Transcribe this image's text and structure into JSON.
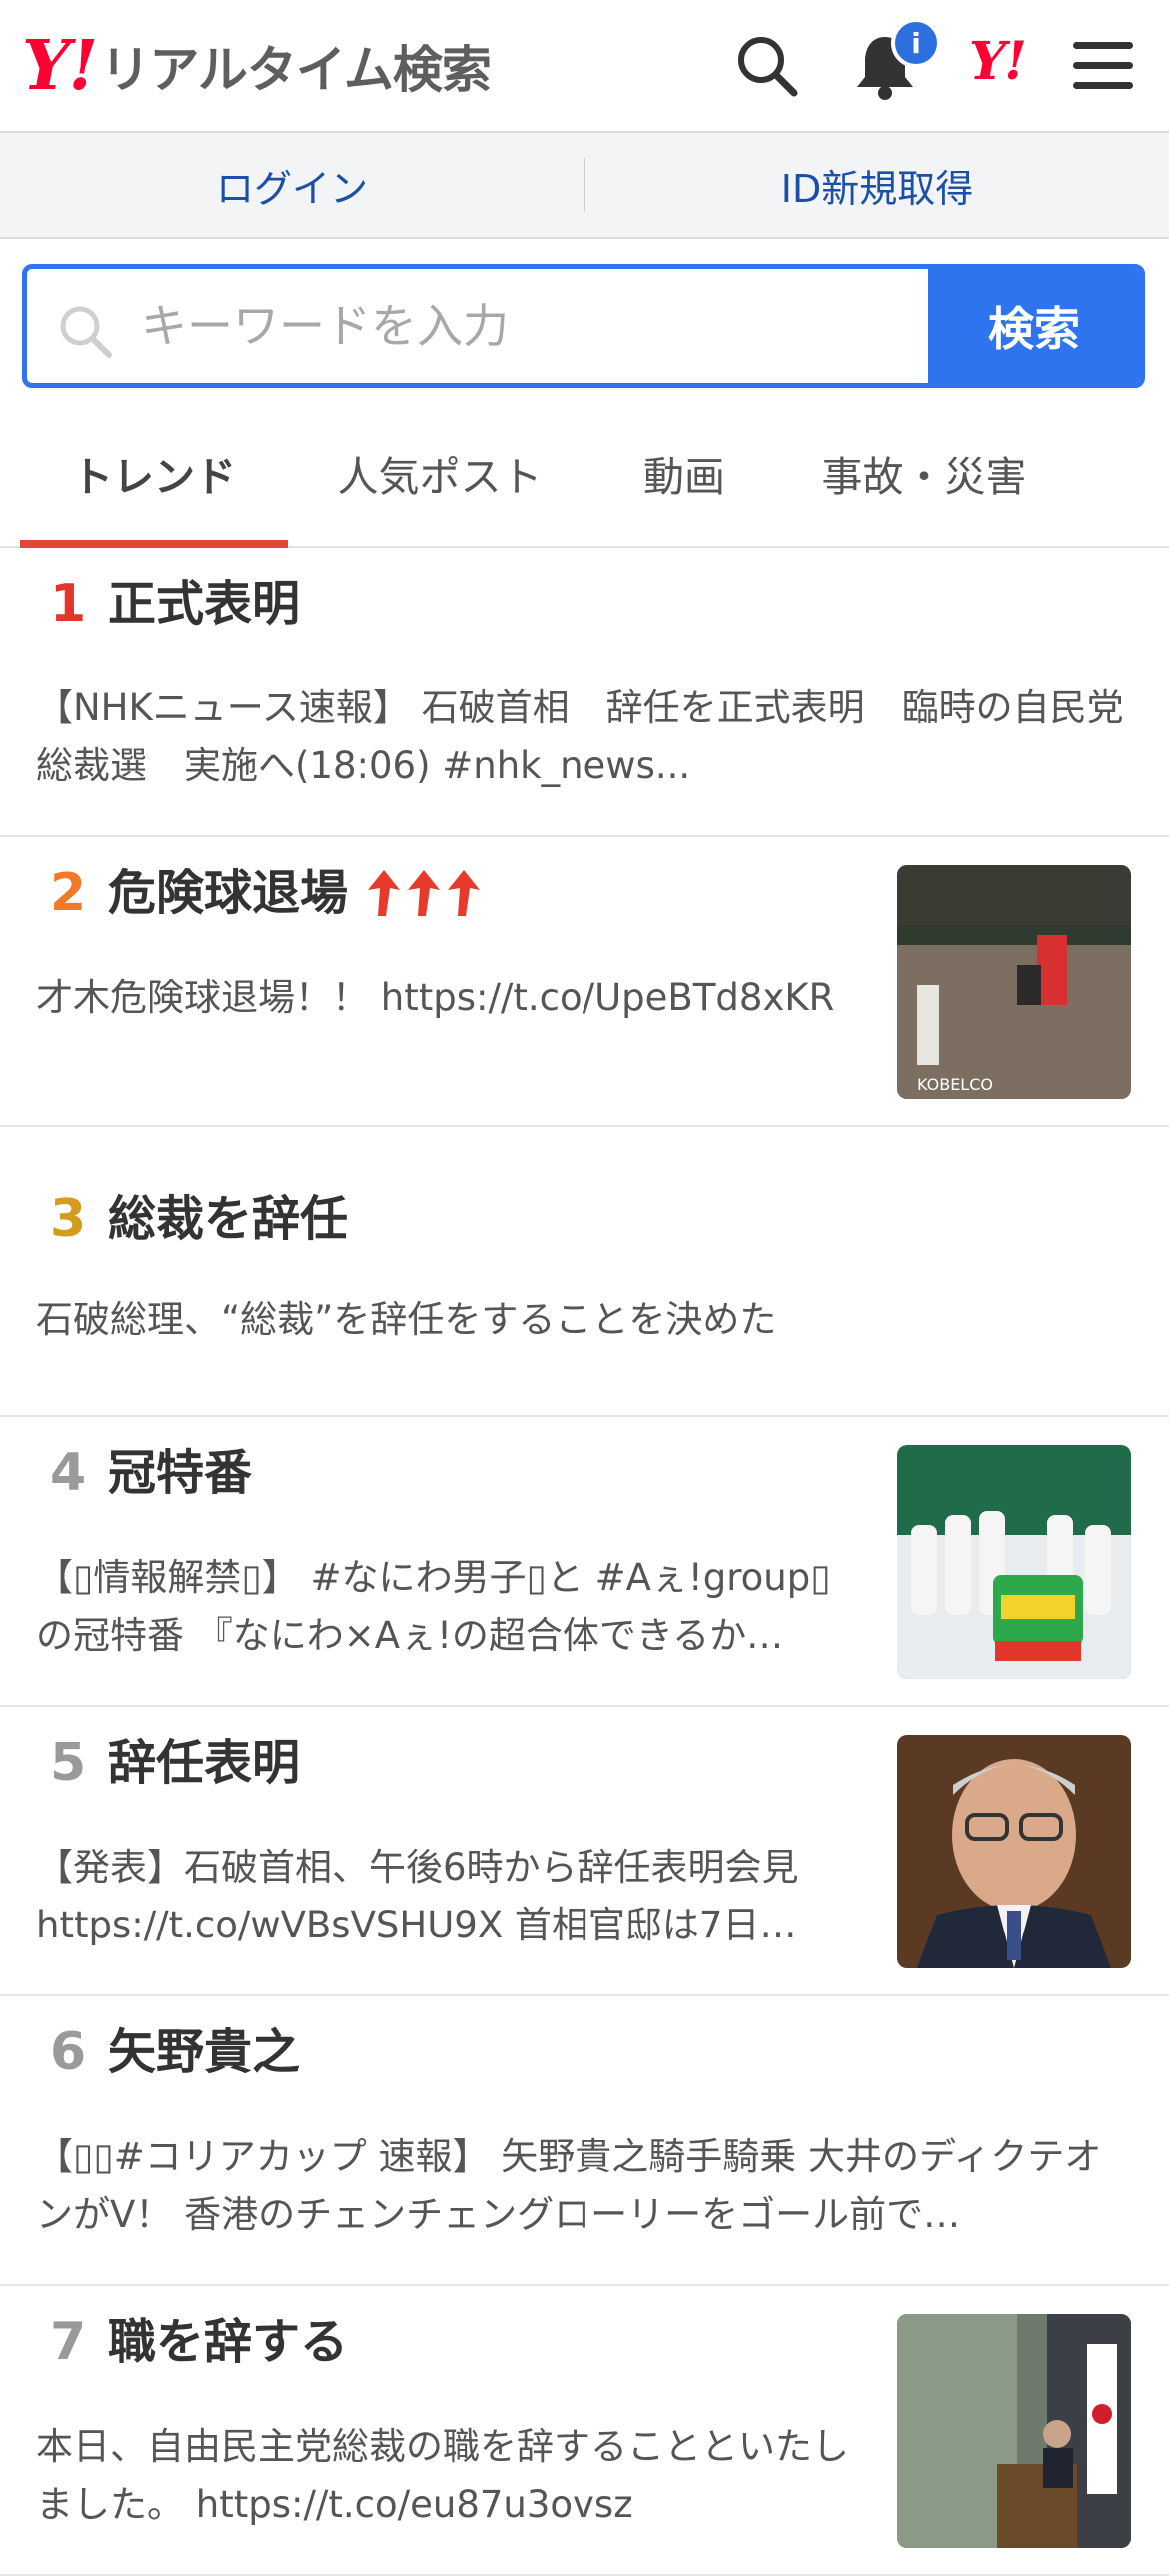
{
  "header": {
    "logo_y": "Y!",
    "logo_title": "リアルタイム検索",
    "notification_badge": "i",
    "yj_logo": "Y!"
  },
  "loginbar": {
    "login": "ログイン",
    "signup": "ID新規取得"
  },
  "search": {
    "placeholder": "キーワードを入力",
    "button": "検索"
  },
  "tabs": [
    {
      "label": "トレンド"
    },
    {
      "label": "人気ポスト"
    },
    {
      "label": "動画"
    },
    {
      "label": "事故・災害"
    }
  ],
  "trends": [
    {
      "rank": "1",
      "title": "正式表明",
      "desc": "【NHKニュース速報】 石破首相　辞任を正式表明　臨時の自民党総裁選　実施へ(18:06) #nhk_news...",
      "rank_color": "#e2362b"
    },
    {
      "rank": "2",
      "title": "危険球退場",
      "desc": "才木危険球退場！！ https://t.co/UpeBTd8xKR",
      "rank_color": "#f07a27",
      "trend_arrows": 3
    },
    {
      "rank": "3",
      "title": "総裁を辞任",
      "desc": "石破総理、“総裁”を辞任をすることを決めた",
      "rank_color": "#d59b1b"
    },
    {
      "rank": "4",
      "title": "冠特番",
      "desc": "【▯情報解禁▯】 #なにわ男子▯と #Aぇ!group▯の冠特番 『なにわ×Aぇ!の超合体できるか…",
      "rank_color": "#9a9a9a"
    },
    {
      "rank": "5",
      "title": "辞任表明",
      "desc": "【発表】石破首相、午後6時から辞任表明会見 https://t.co/wVBsVSHU9X 首相官邸は7日…",
      "rank_color": "#9a9a9a"
    },
    {
      "rank": "6",
      "title": "矢野貴之",
      "desc": "【▯▯#コリアカップ 速報】 矢野貴之騎手騎乗 大井のディクテオンがV！ 香港のチェンチェングローリーをゴール前で…",
      "rank_color": "#9a9a9a"
    },
    {
      "rank": "7",
      "title": "職を辞する",
      "desc": "本日、自由民主党総裁の職を辞することといたしました。 https://t.co/eu87u3ovsz",
      "rank_color": "#9a9a9a"
    }
  ]
}
